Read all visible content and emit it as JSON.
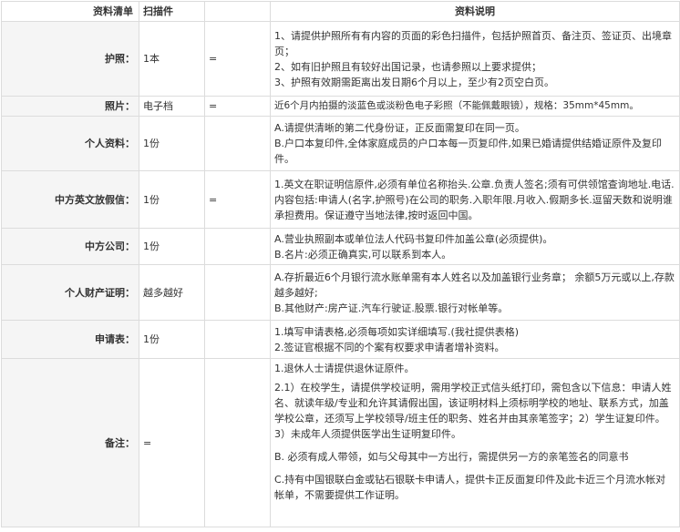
{
  "headers": {
    "col1": "资料清单",
    "col2": "扫描件",
    "col3": "资料说明"
  },
  "rows": [
    {
      "label": "护照：",
      "scan": "1本",
      "blank": "=",
      "desc": [
        "1、请提供护照所有有内容的页面的彩色扫描件，包括护照首页、备注页、签证页、出境章页；",
        "2、如有旧护照且有较好出国记录，也请参照以上要求提供；",
        "3、护照有效期需距离出发日期6个月以上，至少有2页空白页。"
      ]
    },
    {
      "label": "照片：",
      "scan": "电子档",
      "blank": "=",
      "desc": [
        "近6个月内拍摄的淡蓝色或淡粉色电子彩照（不能佩戴眼镜），规格：35mm*45mm。"
      ]
    },
    {
      "label": "个人资料：",
      "scan": "1份",
      "blank": "",
      "desc": [
        "A.请提供清晰的第二代身份证，正反面需复印在同一页。",
        "B.户口本复印件,全体家庭成员的户口本每一页复印件,如果已婚请提供结婚证原件及复印件。"
      ]
    },
    {
      "label": "中方英文放假信：",
      "scan": "1份",
      "blank": "=",
      "desc": [
        "1.英文在职证明信原件,必须有单位名称抬头.公章.负责人签名;须有可供领馆查询地址.电话.内容包括:申请人(名字,护照号)在公司的职务.入职年限.月收入.假期多长.逗留天数和说明谁承担费用。保证遵守当地法律,按时返回中国。"
      ]
    },
    {
      "label": "中方公司：",
      "scan": "1份",
      "blank": "",
      "desc": [
        "A.营业执照副本或单位法人代码书复印件加盖公章(必须提供)。",
        "B.名片:必须正确真实,可以联系到本人。"
      ]
    },
    {
      "label": "个人财产证明：",
      "scan": "越多越好",
      "blank": "",
      "desc": [
        "A.存折最近6个月银行流水账单需有本人姓名以及加盖银行业务章； 余额5万元或以上,存款越多越好;",
        "B.其他财产:房产证.汽车行驶证.股票.银行对帐单等。"
      ]
    },
    {
      "label": "申请表：",
      "scan": "1份",
      "blank": "",
      "desc": [
        "1.填写申请表格,必须每项如实详细填写.(我社提供表格)",
        "2.签证官根据不同的个案有权要求申请者增补资料。"
      ]
    },
    {
      "label": "备注：",
      "scan": "=",
      "blank": "",
      "desc": [
        "1.退休人士请提供退休证原件。",
        "2.1）在校学生，请提供学校证明，需用学校正式信头纸打印，需包含以下信息：申请人姓名、就读年级/专业和允许其请假出国，该证明材料上须标明学校的地址、联系方式，加盖学校公章，还须写上学校领导/班主任的职务、姓名并由其亲笔签字；2）学生证复印件。3）未成年人须提供医学出生证明复印件。",
        "B. 必须有成人带领，如与父母其中一方出行，需提供另一方的亲笔签名的同意书",
        "C.持有中国银联白金或钻石银联卡申请人，提供卡正反面复印件及此卡近三个月流水帐对帐单，不需要提供工作证明。"
      ]
    }
  ]
}
